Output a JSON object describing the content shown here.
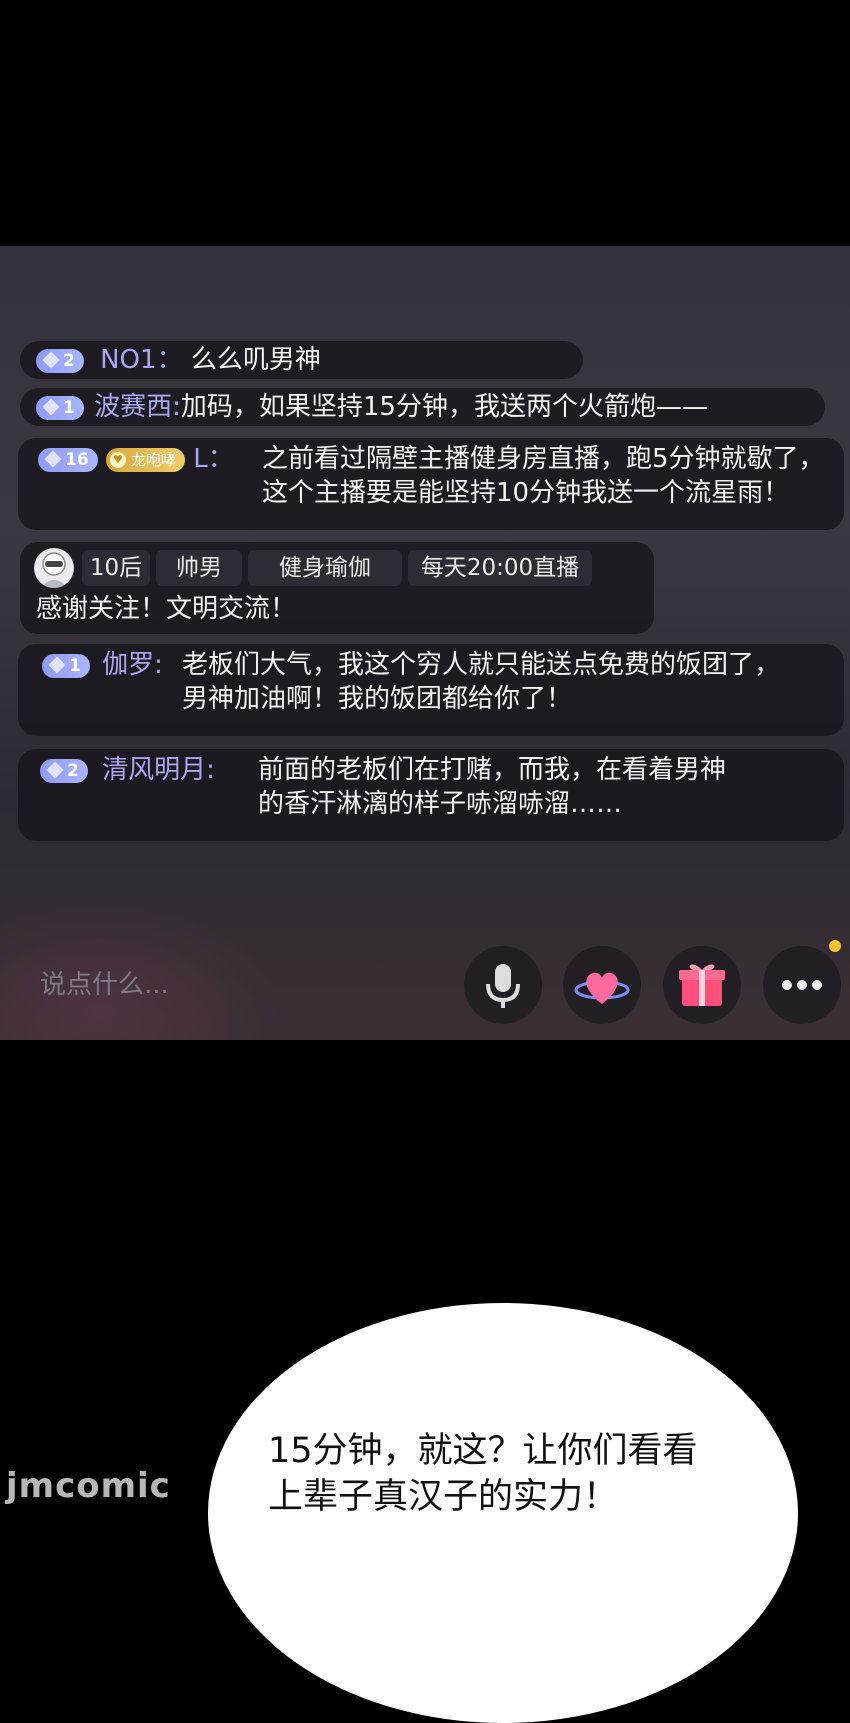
{
  "chat": {
    "messages": [
      {
        "badge_level": "2",
        "username": "NO1：",
        "text": "么么叽男神"
      },
      {
        "badge_level": "1",
        "username": "波赛西:",
        "text": "加码，如果坚持15分钟，我送两个火箭炮——"
      },
      {
        "badge_level": "16",
        "fan_badge": "龙咆哮",
        "username": "L：",
        "text_line1": "之前看过隔壁主播健身房直播，跑5分钟就歇了，",
        "text_line2": "这个主播要是能坚持10分钟我送一个流星雨！"
      },
      {
        "badge_level": "1",
        "username": "伽罗:",
        "text_line1": "老板们大气，我这个穷人就只能送点免费的饭团了，",
        "text_line2": "男神加油啊！我的饭团都给你了！"
      },
      {
        "badge_level": "2",
        "username": "清风明月:",
        "text_line1": "前面的老板们在打赌，而我，在看着男神",
        "text_line2": "的香汗淋漓的样子哧溜哧溜……"
      }
    ],
    "host_card": {
      "tags": [
        "10后",
        "帅男",
        "健身瑜伽",
        "每天20:00直播"
      ],
      "notice": "感谢关注！文明交流！"
    }
  },
  "input_bar": {
    "placeholder": "说点什么...",
    "icons": [
      "microphone-icon",
      "heart-icon",
      "gift-icon",
      "more-icon"
    ],
    "notification_dot_color": "#f1c232"
  },
  "speech_bubble": {
    "line1": "15分钟，就这？让你们看看",
    "line2": "上辈子真汉子的实力！"
  },
  "watermark": "jmcomic",
  "colors": {
    "username": "#a9a6f0",
    "badge": "#8e9bf5",
    "gift": "#ff4f7a"
  }
}
